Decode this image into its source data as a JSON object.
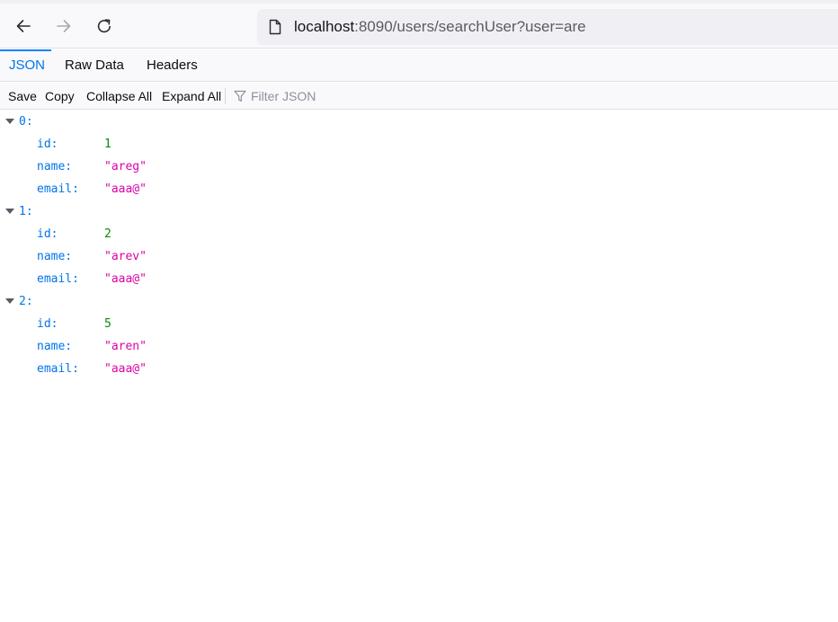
{
  "browser": {
    "url_host": "localhost",
    "url_rest": ":8090/users/searchUser?user=are",
    "icons": [
      "back-arrow-icon",
      "forward-arrow-icon",
      "reload-icon",
      "page-icon"
    ]
  },
  "viewer": {
    "tabs": [
      {
        "label": "JSON",
        "selected": true
      },
      {
        "label": "Raw Data",
        "selected": false
      },
      {
        "label": "Headers",
        "selected": false
      }
    ],
    "toolbar": {
      "save": "Save",
      "copy": "Copy",
      "collapse_all": "Collapse All",
      "expand_all": "Expand All",
      "filter_placeholder": "Filter JSON"
    }
  },
  "json": {
    "items": [
      {
        "index": "0:",
        "id_key": "id:",
        "id": "1",
        "name_key": "name:",
        "name": "\"areg\"",
        "email_key": "email:",
        "email": "\"aaa@\""
      },
      {
        "index": "1:",
        "id_key": "id:",
        "id": "2",
        "name_key": "name:",
        "name": "\"arev\"",
        "email_key": "email:",
        "email": "\"aaa@\""
      },
      {
        "index": "2:",
        "id_key": "id:",
        "id": "5",
        "name_key": "name:",
        "name": "\"aren\"",
        "email_key": "email:",
        "email": "\"aaa@\""
      }
    ]
  },
  "colors": {
    "key": "#0074e8",
    "number": "#058b00",
    "string": "#dd00a9",
    "selected_tab": "#0074e8"
  }
}
